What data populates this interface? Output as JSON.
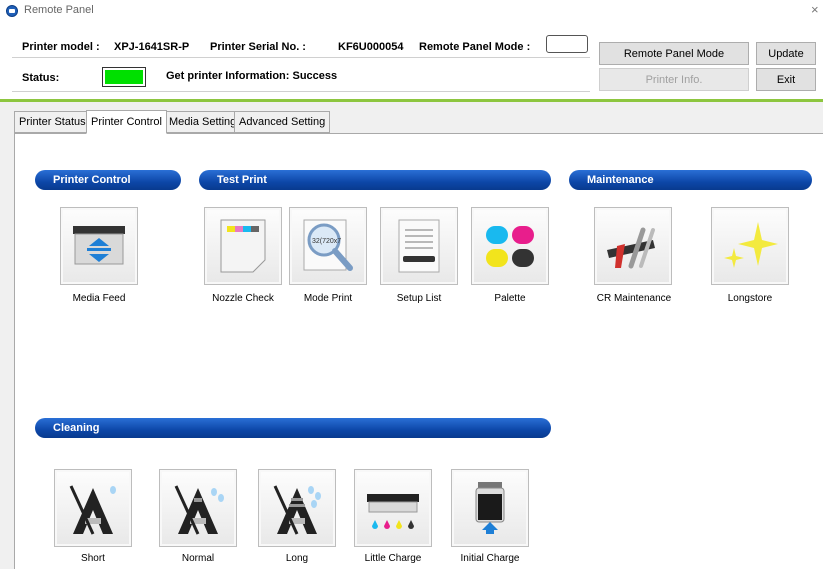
{
  "window": {
    "title": "Remote Panel",
    "close_glyph": "×"
  },
  "header": {
    "printer_model_label": "Printer model :",
    "printer_model_value": "XPJ-1641SR-P",
    "serial_label": "Printer Serial No. :",
    "serial_value": "KF6U000054",
    "panel_mode_label": "Remote Panel Mode :",
    "panel_mode_value": "",
    "status_label": "Status:",
    "status_color": "#00e000",
    "status_message": "Get printer Information: Success"
  },
  "buttons": {
    "remote_panel_mode": "Remote Panel Mode",
    "update": "Update",
    "printer_info": "Printer Info.",
    "exit": "Exit"
  },
  "tabs": [
    {
      "label": "Printer Status",
      "active": false
    },
    {
      "label": "Printer Control",
      "active": true
    },
    {
      "label": "Media Setting",
      "active": false
    },
    {
      "label": "Advanced Setting",
      "active": false
    }
  ],
  "sections": {
    "printer_control": {
      "title": "Printer Control",
      "items": [
        {
          "label": "Media Feed",
          "icon": "media-feed-icon"
        }
      ]
    },
    "test_print": {
      "title": "Test Print",
      "items": [
        {
          "label": "Nozzle Check",
          "icon": "nozzle-check-icon"
        },
        {
          "label": "Mode Print",
          "icon": "mode-print-icon",
          "icon_text": "32(720x7"
        },
        {
          "label": "Setup List",
          "icon": "setup-list-icon"
        },
        {
          "label": "Palette",
          "icon": "palette-icon"
        }
      ]
    },
    "maintenance": {
      "title": "Maintenance",
      "items": [
        {
          "label": "CR Maintenance",
          "icon": "cr-maintenance-icon"
        },
        {
          "label": "Longstore",
          "icon": "longstore-icon"
        }
      ]
    },
    "cleaning": {
      "title": "Cleaning",
      "items": [
        {
          "label": "Short",
          "icon": "cleaning-short-icon"
        },
        {
          "label": "Normal",
          "icon": "cleaning-normal-icon"
        },
        {
          "label": "Long",
          "icon": "cleaning-long-icon"
        },
        {
          "label": "Little Charge",
          "icon": "little-charge-icon"
        },
        {
          "label": "Initial Charge",
          "icon": "initial-charge-icon"
        }
      ]
    }
  },
  "colors": {
    "accent_green": "#8dc63f",
    "section_blue": "#0d47a8",
    "ink_cyan": "#19b9ef",
    "ink_magenta": "#e81e8c",
    "ink_yellow": "#f2e41c",
    "ink_black": "#333333"
  }
}
